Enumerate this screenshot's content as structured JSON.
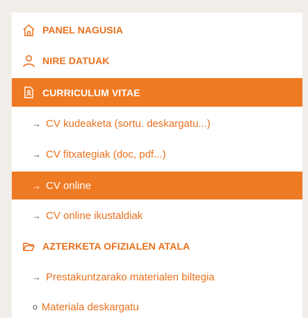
{
  "menu": {
    "panel_nagusia": "PANEL NAGUSIA",
    "nire_datuak": "NIRE DATUAK",
    "curriculum_vitae": "CURRICULUM VITAE",
    "cv_kudeaketa": "CV kudeaketa (sortu. deskargatu...)",
    "cv_fitxategiak": "CV fitxategiak (doc, pdf...)",
    "cv_online": "CV online",
    "cv_online_ikustaldiak": "CV online ikustaldiak",
    "azterketa": "AZTERKETA OFIZIALEN ATALA",
    "prestakuntza": "Prestakuntzarako materialen biltegia",
    "materiala": "Materiala deskargatu"
  },
  "glyphs": {
    "arrow": "→",
    "bullet": "o"
  },
  "colors": {
    "accent": "#ef7a24",
    "text_orange": "#e8711e",
    "background": "#f1eeea",
    "panel": "#ffffff"
  },
  "icons": {
    "panel_nagusia": "home-icon",
    "nire_datuak": "user-icon",
    "curriculum_vitae": "document-user-icon",
    "azterketa": "folder-open-icon"
  }
}
